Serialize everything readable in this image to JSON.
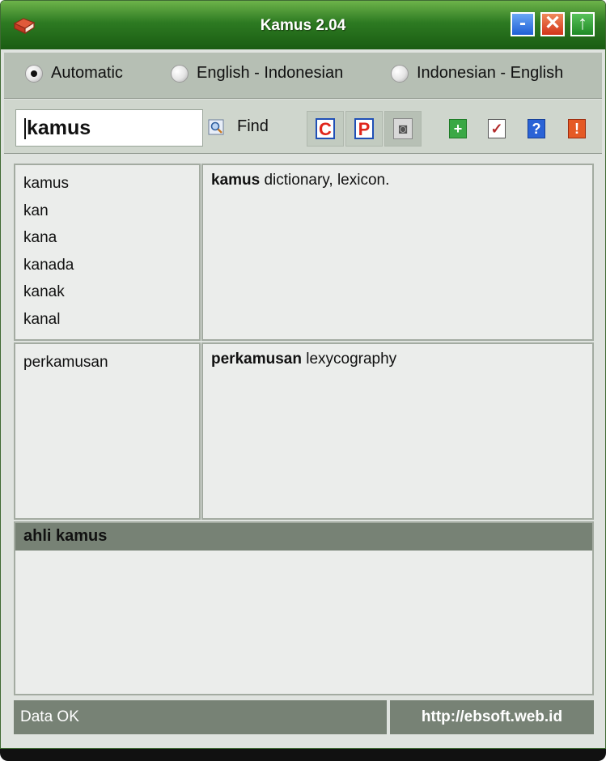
{
  "window": {
    "title": "Kamus 2.04"
  },
  "title_buttons": {
    "minimize": "-",
    "close": "✕",
    "up": "↑"
  },
  "modes": [
    {
      "label": "Automatic",
      "checked": true
    },
    {
      "label": "English - Indonesian",
      "checked": false
    },
    {
      "label": "Indonesian - English",
      "checked": false
    }
  ],
  "search": {
    "value": "kamus",
    "find_label": "Find"
  },
  "toolbar_icons": [
    {
      "name": "copy-icon",
      "glyph": "C",
      "color": "#e0261c"
    },
    {
      "name": "paste-icon",
      "glyph": "P",
      "color": "#e0261c"
    },
    {
      "name": "camera-icon",
      "glyph": "◙",
      "color": "#7b7b7b"
    },
    {
      "name": "add-icon",
      "glyph": "+",
      "color": "#2fa83a"
    },
    {
      "name": "checklist-icon",
      "glyph": "✓",
      "color": "#b22a2a"
    },
    {
      "name": "help-icon",
      "glyph": "?",
      "color": "#1f5fd6"
    },
    {
      "name": "alert-icon",
      "glyph": "!",
      "color": "#e0261c"
    }
  ],
  "word_list": [
    "kamus",
    "kan",
    "kana",
    "kanada",
    "kanak",
    "kanal"
  ],
  "definition": {
    "word": "kamus",
    "meaning": " dictionary, lexicon."
  },
  "related_list": [
    "perkamusan"
  ],
  "related_definition": {
    "word": "perkamusan",
    "meaning": " lexycography"
  },
  "phrase_panel": {
    "heading": "ahli kamus"
  },
  "status": {
    "text": "Data OK",
    "url": "http://ebsoft.web.id"
  }
}
